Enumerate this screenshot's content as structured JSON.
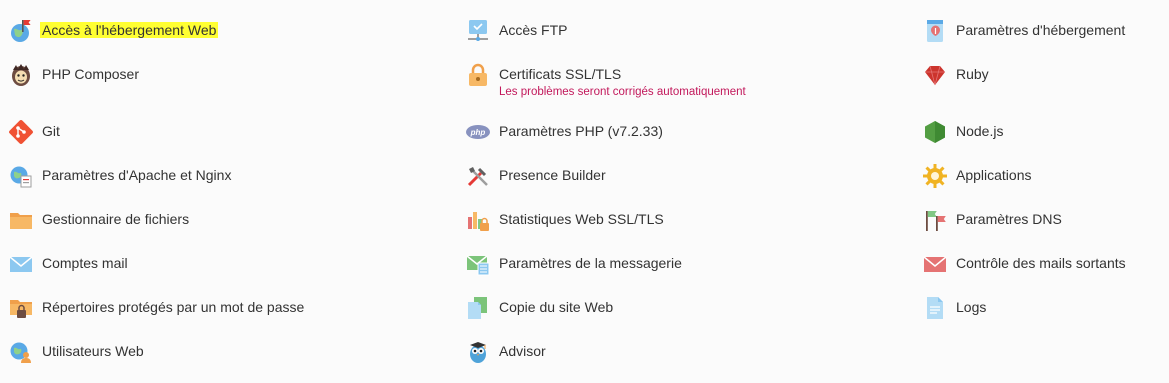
{
  "tools": {
    "col1": [
      {
        "label": "Accès à l'hébergement Web",
        "icon": "globe-flag-icon",
        "highlight_color": "#ffff33"
      },
      {
        "label": "PHP Composer",
        "icon": "php-composer-icon"
      },
      {
        "label": "Git",
        "icon": "git-icon"
      },
      {
        "label": "Paramètres d'Apache et Nginx",
        "icon": "apache-nginx-icon"
      },
      {
        "label": "Gestionnaire de fichiers",
        "icon": "folder-icon"
      },
      {
        "label": "Comptes mail",
        "icon": "envelope-icon"
      },
      {
        "label": "Répertoires protégés par un mot de passe",
        "icon": "locked-folder-icon"
      },
      {
        "label": "Utilisateurs Web",
        "icon": "web-user-icon"
      }
    ],
    "col2": [
      {
        "label": "Accès FTP",
        "icon": "ftp-icon"
      },
      {
        "label": "Certificats SSL/TLS",
        "icon": "padlock-icon",
        "note": "Les problèmes seront corrigés automatiquement",
        "note_color": "#c2185b"
      },
      {
        "label": "Paramètres PHP (v7.2.33)",
        "icon": "php-icon"
      },
      {
        "label": "Presence Builder",
        "icon": "tools-icon"
      },
      {
        "label": "Statistiques Web SSL/TLS",
        "icon": "stats-lock-icon"
      },
      {
        "label": "Paramètres de la messagerie",
        "icon": "mail-settings-icon"
      },
      {
        "label": "Copie du site Web",
        "icon": "copy-site-icon"
      },
      {
        "label": "Advisor",
        "icon": "owl-icon"
      }
    ],
    "col3": [
      {
        "label": "Paramètres d'hébergement",
        "icon": "hosting-settings-icon"
      },
      {
        "label": "Ruby",
        "icon": "ruby-icon"
      },
      {
        "label": "Node.js",
        "icon": "nodejs-icon"
      },
      {
        "label": "Applications",
        "icon": "gear-icon"
      },
      {
        "label": "Paramètres DNS",
        "icon": "dns-flags-icon"
      },
      {
        "label": "Contrôle des mails sortants",
        "icon": "outgoing-mail-icon"
      },
      {
        "label": "Logs",
        "icon": "logs-icon"
      }
    ]
  }
}
